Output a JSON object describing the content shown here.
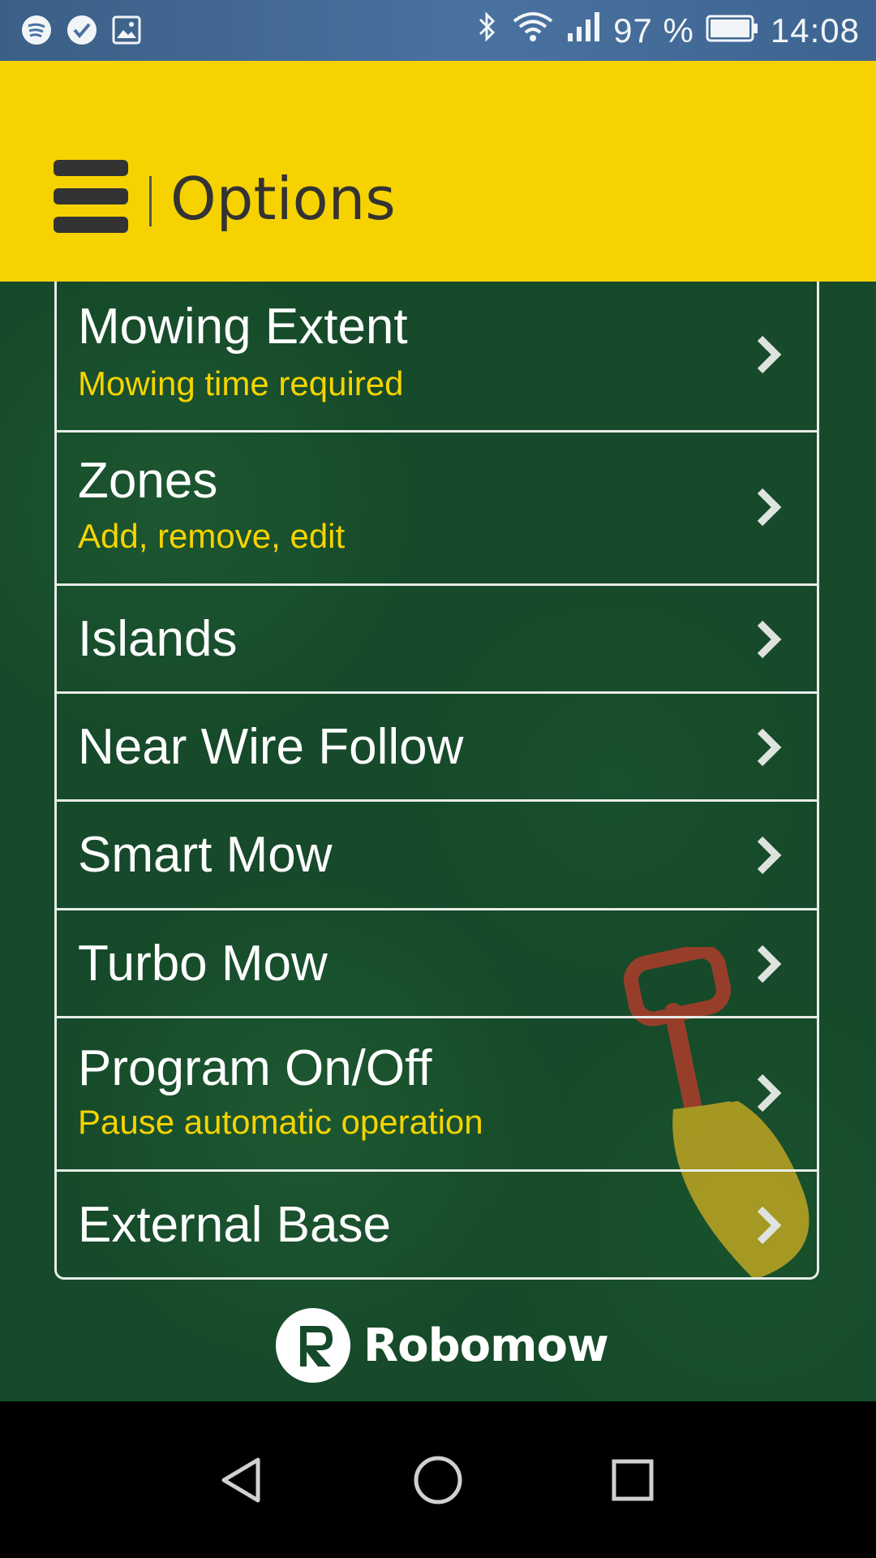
{
  "status_bar": {
    "battery": "97 %",
    "time": "14:08",
    "icons": [
      "spotify-icon",
      "check-circle-icon",
      "image-icon",
      "bluetooth-icon",
      "wifi-icon",
      "signal-icon",
      "battery-icon"
    ]
  },
  "app_bar": {
    "title": "Options",
    "menu_icon": "hamburger-icon"
  },
  "menu": {
    "items": [
      {
        "label": "Mowing Extent",
        "subtitle": "Mowing time required"
      },
      {
        "label": "Zones",
        "subtitle": "Add, remove, edit"
      },
      {
        "label": "Islands",
        "subtitle": ""
      },
      {
        "label": "Near Wire Follow",
        "subtitle": ""
      },
      {
        "label": "Smart Mow",
        "subtitle": ""
      },
      {
        "label": "Turbo Mow",
        "subtitle": ""
      },
      {
        "label": "Program On/Off",
        "subtitle": "Pause automatic operation"
      },
      {
        "label": "External Base",
        "subtitle": ""
      }
    ],
    "item_icon": "chevron-right-icon"
  },
  "brand": {
    "name": "Robomow",
    "mark": "R"
  },
  "nav_bar": {
    "buttons": [
      "back-icon",
      "home-icon",
      "recents-icon"
    ]
  },
  "colors": {
    "accent": "#f6d300",
    "status_bar": "#4a72a0",
    "background": "#164a2a",
    "title_text": "#333333"
  }
}
